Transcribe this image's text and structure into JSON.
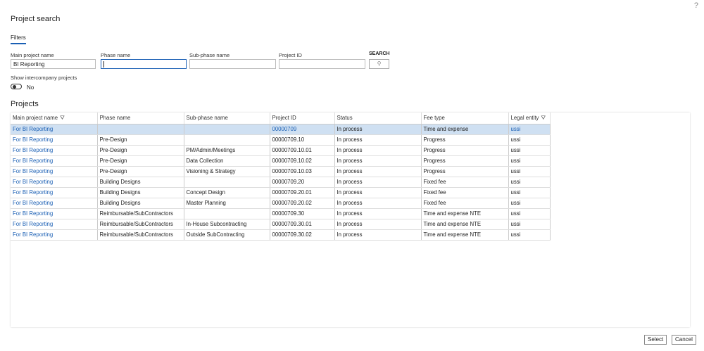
{
  "title": "Project search",
  "help": "?",
  "tab": "Filters",
  "filters": {
    "main_label": "Main project name",
    "main_value": "BI Reporting",
    "phase_label": "Phase name",
    "phase_value": "",
    "sub_label": "Sub-phase name",
    "sub_value": "",
    "id_label": "Project ID",
    "id_value": "",
    "search_label": "SEARCH",
    "search_icon": "⚲",
    "interco_label": "Show intercompany projects",
    "interco_value": "No"
  },
  "grid_title": "Projects",
  "columns": [
    "Main project name",
    "Phase name",
    "Sub-phase name",
    "Project ID",
    "Status",
    "Fee type",
    "Legal entity"
  ],
  "filter_icon": "⛛",
  "rows": [
    [
      "For BI Reporting",
      "",
      "",
      "00000709",
      "In process",
      "Time and expense",
      "ussi"
    ],
    [
      "For BI Reporting",
      "Pre-Design",
      "",
      "00000709.10",
      "In process",
      "Progress",
      "ussi"
    ],
    [
      "For BI Reporting",
      "Pre-Design",
      "PM/Admin/Meetings",
      "00000709.10.01",
      "In process",
      "Progress",
      "ussi"
    ],
    [
      "For BI Reporting",
      "Pre-Design",
      "Data Collection",
      "00000709.10.02",
      "In process",
      "Progress",
      "ussi"
    ],
    [
      "For BI Reporting",
      "Pre-Design",
      "Visioning & Strategy",
      "00000709.10.03",
      "In process",
      "Progress",
      "ussi"
    ],
    [
      "For BI Reporting",
      "Building Designs",
      "",
      "00000709.20",
      "In process",
      "Fixed fee",
      "ussi"
    ],
    [
      "For BI Reporting",
      "Building Designs",
      "Concept Design",
      "00000709.20.01",
      "In process",
      "Fixed fee",
      "ussi"
    ],
    [
      "For BI Reporting",
      "Building Designs",
      "Master Planning",
      "00000709.20.02",
      "In process",
      "Fixed fee",
      "ussi"
    ],
    [
      "For BI Reporting",
      "Reimbursable/SubContractors",
      "",
      "00000709.30",
      "In process",
      "Time and expense NTE",
      "ussi"
    ],
    [
      "For BI Reporting",
      "Reimbursable/SubContractors",
      "In-House Subcontracting",
      "00000709.30.01",
      "In process",
      "Time and expense NTE",
      "ussi"
    ],
    [
      "For BI Reporting",
      "Reimbursable/SubContractors",
      "Outside SubContracting",
      "00000709.30.02",
      "In process",
      "Time and expense NTE",
      "ussi"
    ]
  ],
  "buttons": {
    "select": "Select",
    "cancel": "Cancel"
  }
}
